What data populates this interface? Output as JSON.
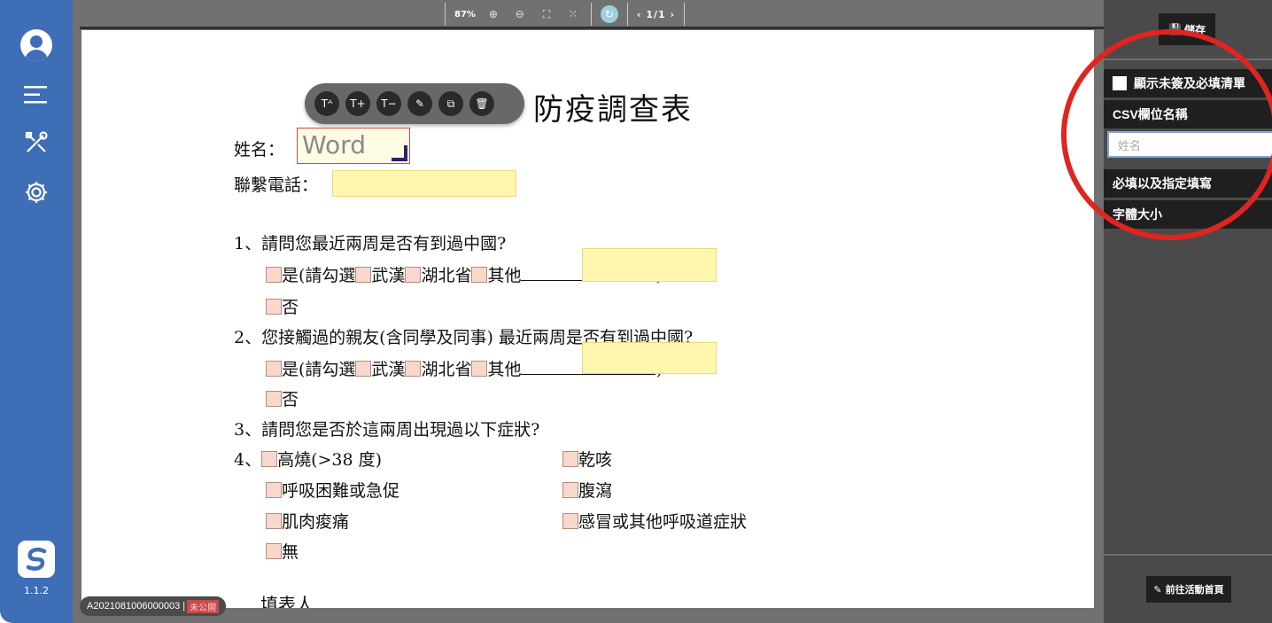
{
  "sidebar": {
    "version": "1.1.2"
  },
  "toolbar": {
    "zoom": "87%",
    "page": "1/1"
  },
  "document": {
    "title": "防疫調查表",
    "name_label": "姓名：",
    "name_field_value": "Word",
    "phone_label": "聯繫電話：",
    "q1": "1、請問您最近兩周是否有到過中國?",
    "q1_yes": "是(請勾選",
    "wuhan": "武漢",
    "hubei": "湖北省",
    "other": "其他",
    "close_paren": ")",
    "no": "否",
    "q2": "2、您接觸過的親友(含同學及同事) 最近兩周是否有到過中國?",
    "q3": "3、請問您是否於這兩周出現過以下症狀?",
    "q4_prefix": "4、",
    "symptom_fever": "高燒(>38 度)",
    "symptom_cough": "乾咳",
    "symptom_breath": "呼吸困難或急促",
    "symptom_diarrhea": "腹瀉",
    "symptom_muscle": "肌肉痠痛",
    "symptom_cold": "感冒或其他呼吸道症狀",
    "symptom_none": "無",
    "filler": "填表人"
  },
  "doc_id": {
    "id": "A2021081006000003 |",
    "status": "未公開"
  },
  "right_panel": {
    "save_label": "儲存",
    "show_unsigned_label": "顯示未簽及必填清單",
    "csv_header": "CSV欄位名稱",
    "csv_input_value": "姓名",
    "required_header": "必填以及指定填寫",
    "font_size_header": "字體大小",
    "go_home_label": "前往活動首頁"
  },
  "colors": {
    "sidebar": "#3e6eb6",
    "highlight_circle": "#e0241f",
    "field_yellow": "#fff7b0"
  }
}
